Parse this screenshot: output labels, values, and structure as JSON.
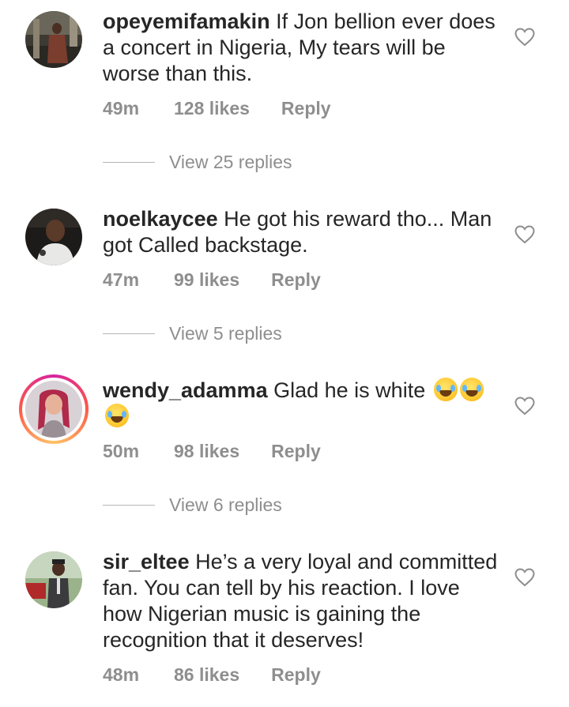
{
  "comments": [
    {
      "username": "opeyemifamakin",
      "text": "If Jon bellion ever does a concert in Nigeria, My tears will be worse than this.",
      "time": "49m",
      "likes": "128 likes",
      "reply": "Reply",
      "view_replies": "View 25 replies",
      "has_story_ring": false
    },
    {
      "username": "noelkaycee",
      "text": "He got his reward tho... Man got Called backstage.",
      "time": "47m",
      "likes": "99 likes",
      "reply": "Reply",
      "view_replies": "View 5 replies",
      "has_story_ring": false
    },
    {
      "username": "wendy_adamma",
      "text": "Glad he is white",
      "emojis": [
        "face-with-tears-of-joy",
        "face-with-tears-of-joy",
        "face-with-tears-of-joy"
      ],
      "time": "50m",
      "likes": "98 likes",
      "reply": "Reply",
      "view_replies": "View 6 replies",
      "has_story_ring": true
    },
    {
      "username": "sir_eltee",
      "text": "He’s a very loyal and committed fan. You can tell by his reaction. I love how Nigerian music is gaining the recognition that it deserves!",
      "time": "48m",
      "likes": "86 likes",
      "reply": "Reply",
      "has_story_ring": false
    }
  ],
  "icons": {
    "like": "heart-outline-icon"
  },
  "colors": {
    "text": "#262626",
    "secondary": "#8e8e8e",
    "story_ring_start": "#d6249f",
    "story_ring_end": "#fdc468"
  }
}
